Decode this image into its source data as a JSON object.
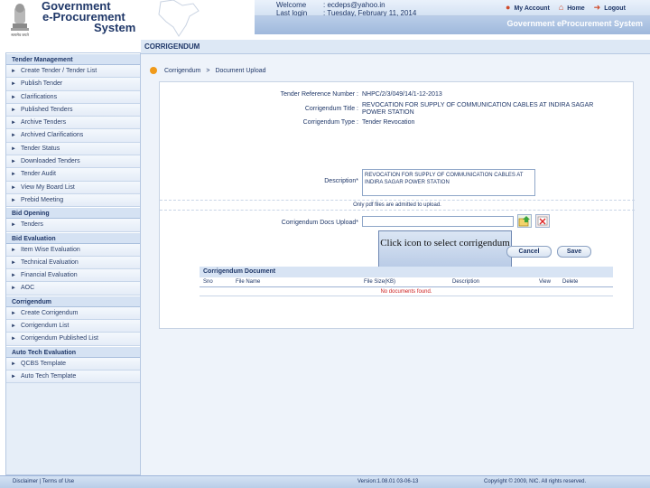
{
  "header": {
    "emblem_caption": "सत्यमेव जयते",
    "brand_line1": "Government",
    "brand_line2": "e-Procurement",
    "brand_line3": "System",
    "welcome_label": "Welcome",
    "welcome_value": ": ecdeps@yahoo.in",
    "last_login_label": "Last login",
    "last_login_value": ": Tuesday, February 11, 2014",
    "my_account": "My Account",
    "home": "Home",
    "logout": "Logout",
    "system_title": "Government eProcurement System",
    "icons": [
      "user-icon",
      "home-icon",
      "logout-icon"
    ]
  },
  "sidebar": {
    "sections": [
      {
        "title": "Tender Management",
        "items": [
          "Create Tender / Tender List",
          "Publish Tender",
          "Clarifications",
          "Published Tenders",
          "Archive Tenders",
          "Archived Clarifications",
          "Tender Status",
          "Downloaded Tenders",
          "Tender Audit",
          "View My Board List",
          "Prebid Meeting"
        ]
      },
      {
        "title": "Bid Opening",
        "items": [
          "Tenders"
        ]
      },
      {
        "title": "Bid Evaluation",
        "items": [
          "Item Wise Evaluation",
          "Technical Evaluation",
          "Financial Evaluation",
          "AOC"
        ]
      },
      {
        "title": "Corrigendum",
        "items": [
          "Create Corrigendum",
          "Corrigendum List",
          "Corrigendum Published List"
        ]
      },
      {
        "title": "Auto Tech Evaluation",
        "items": [
          "QCBS Template",
          "Auto Tech Template"
        ]
      }
    ]
  },
  "main": {
    "page_title": "CORRIGENDUM",
    "breadcrumb_1": "Corrigendum",
    "breadcrumb_sep": ">",
    "breadcrumb_2": "Document Upload",
    "fields": {
      "tender_ref_label": "Tender Reference Number :",
      "tender_ref_value": "NHPC/2/3/049/14/1-12-2013",
      "corrigendum_title_label": "Corrigendum Title :",
      "corrigendum_title_value": "REVOCATION FOR SUPPLY OF COMMUNICATION CABLES AT INDIRA SAGAR POWER STATION",
      "corrigendum_type_label": "Corrigendum Type :",
      "corrigendum_type_value": "Tender Revocation",
      "description_label": "Description*",
      "description_value": "REVOCATION FOR SUPPLY OF COMMUNICATION CABLES AT INDIRA SAGAR POWER STATION",
      "pdf_note": "Only pdf files are admitted to upload.",
      "upload_label": "Corrigendum Docs Upload*"
    },
    "callout": "Click icon to select corrigendum",
    "cancel_label": "Cancel",
    "save_label": "Save",
    "table": {
      "title": "Corrigendum Document",
      "columns": [
        "Sno",
        "File Name",
        "File Size(KB)",
        "Description",
        "View",
        "Delete"
      ],
      "empty_message": "No documents found."
    }
  },
  "footer": {
    "links": "Disclaimer  |  Terms of Use",
    "version": "Version:1.08.01 03-06-13",
    "copyright": "Copyright © 2009, NIC. All rights reserved."
  }
}
